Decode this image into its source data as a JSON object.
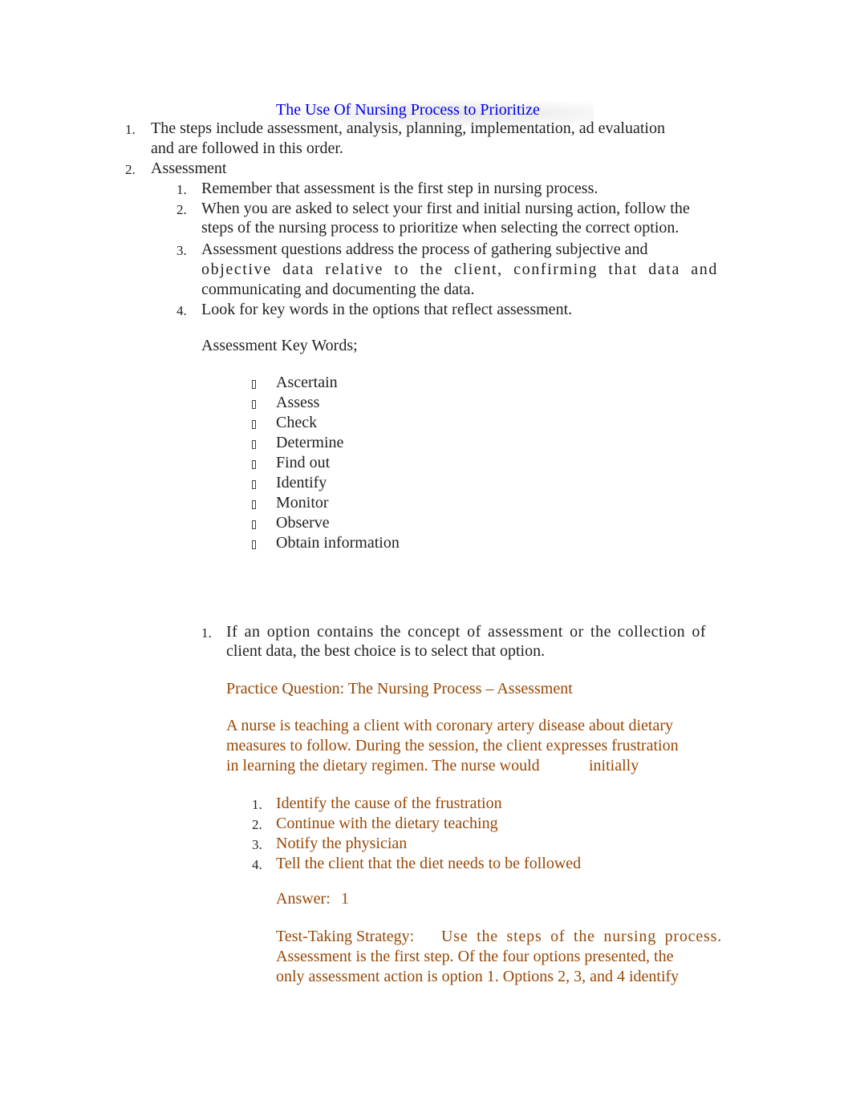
{
  "document": {
    "title": "The Use Of Nursing Process to Prioritize",
    "colors": {
      "title": "#0000ee",
      "body_text": "#222222",
      "practice_text": "#984806"
    },
    "main_list": [
      {
        "marker": "1.",
        "lines": [
          "The steps include assessment, analysis, planning, implementation, ad evaluation",
          "and are followed in this order."
        ]
      },
      {
        "marker": "2.",
        "lines": [
          "Assessment"
        ]
      }
    ],
    "assessment_list": [
      {
        "marker": "1.",
        "lines": [
          "Remember that assessment is the first step in nursing process."
        ]
      },
      {
        "marker": "2.",
        "lines": [
          "When you are asked to select your first and initial nursing action, follow the",
          "steps of the nursing process to prioritize when selecting the correct option."
        ]
      },
      {
        "marker": "3.",
        "lines": [
          "Assessment questions address the process of gathering subjective and",
          "objective data relative to the client, confirming that data and",
          "communicating and documenting the data."
        ]
      },
      {
        "marker": "4.",
        "lines": [
          "Look for key words in the options that reflect assessment."
        ]
      }
    ],
    "key_words_heading": "Assessment Key Words;",
    "key_words_bullet_icon": "missing-glyph-bullet",
    "key_words": [
      "Ascertain",
      "Assess",
      "Check",
      "Determine",
      "Find out",
      "Identify",
      "Monitor",
      "Observe",
      "Obtain information"
    ],
    "tip": {
      "marker": "1.",
      "lines": [
        "If an option contains the concept of assessment or the collection of",
        "client data, the best choice is to select that option."
      ]
    },
    "practice": {
      "heading": "Practice Question: The Nursing Process – Assessment",
      "question_lines": [
        "A nurse is teaching a client with coronary artery disease about dietary",
        "measures to follow. During the session, the client expresses frustration",
        "in learning the dietary regimen. The nurse would",
        "initially"
      ],
      "options": [
        {
          "marker": "1.",
          "text": "Identify the cause of the frustration"
        },
        {
          "marker": "2.",
          "text": "Continue with the dietary teaching"
        },
        {
          "marker": "3.",
          "text": "Notify the physician"
        },
        {
          "marker": "4.",
          "text": "Tell the client that the diet needs to be followed"
        }
      ],
      "answer_label": "Answer:",
      "answer_value": "1",
      "strategy_label": "Test-Taking Strategy:",
      "strategy_lines": [
        "Use the steps of the nursing process.",
        "Assessment is the first step. Of the four options presented, the",
        "only assessment action is option 1. Options 2, 3, and 4 identify"
      ]
    }
  }
}
